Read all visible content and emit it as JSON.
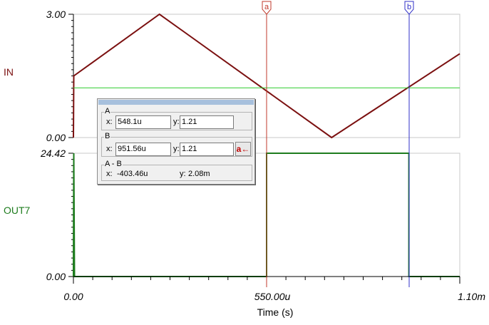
{
  "chart_data": [
    {
      "type": "line",
      "ylabel": "IN",
      "ylim": [
        0,
        3
      ],
      "y_ticks": [
        "3.00",
        "0.00"
      ],
      "series": [
        {
          "name": "IN",
          "color": "#7b1010",
          "x": [
            0,
            1e-06,
            0.000245,
            0.000735,
            0.0011
          ],
          "values": [
            0,
            1.5,
            3.0,
            0.0,
            2.04
          ]
        },
        {
          "color": "#2bcc2b",
          "x": [
            0,
            0.0011
          ],
          "values": [
            1.21,
            1.21
          ]
        }
      ]
    },
    {
      "type": "line",
      "ylabel": "OUT7",
      "ylim": [
        0,
        24.42
      ],
      "y_ticks": [
        "24.42",
        "0.00"
      ],
      "series": [
        {
          "name": "OUT7",
          "color": "#1e7c1e",
          "x": [
            0,
            1e-06,
            3e-06,
            0.00055,
            0.0005501,
            0.000955,
            0.0009551,
            0.0011
          ],
          "values": [
            0,
            24.42,
            0,
            0,
            24.42,
            24.42,
            0,
            0
          ]
        }
      ]
    }
  ],
  "x_axis": {
    "xlabel": "Time (s)",
    "xlim": [
      0,
      0.0011
    ],
    "tick_labels": [
      "0.00",
      "550.00u",
      "1.10m"
    ]
  },
  "cursors": [
    {
      "label": "a",
      "x": 0.00055,
      "color": "#c0392b"
    },
    {
      "label": "b",
      "x": 0.000955,
      "color": "#3030c8"
    }
  ],
  "readout": {
    "a": {
      "title": "A",
      "x_label": "x:",
      "x_value": "548.1u",
      "y_label": "y:",
      "y_value": "1.21"
    },
    "b": {
      "title": "B",
      "x_label": "x:",
      "x_value": "951.56u",
      "y_label": "y:",
      "y_value": "1.21",
      "swap_button": "a←"
    },
    "diff": {
      "title": "A - B",
      "x_label": "x:",
      "x_value": "-403.46u",
      "y_label": "y:",
      "y_value": "2.08m"
    }
  }
}
